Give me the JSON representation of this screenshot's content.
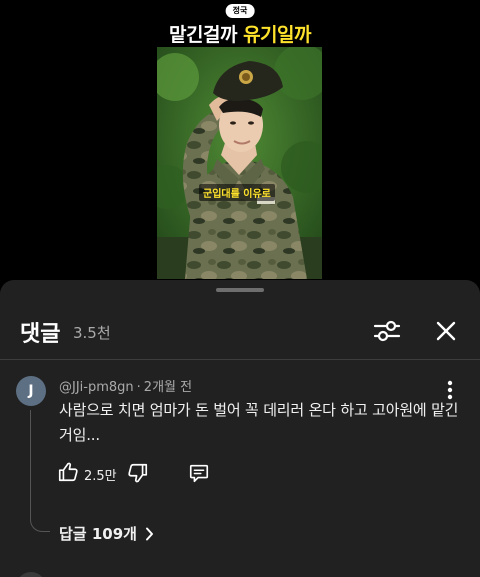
{
  "video": {
    "chip": "정국",
    "headline_white_1": "맡긴걸까 ",
    "headline_yellow": "유기일까",
    "caption": "군입대를 이유로"
  },
  "comments_panel": {
    "title": "댓글",
    "count": "3.5천",
    "icons": {
      "filter": "tune-icon",
      "close": "close-icon"
    }
  },
  "comment": {
    "avatar_letter": "J",
    "author": "@JJi-pm8gn",
    "separator": "·",
    "time": "2개월 전",
    "text": "사람으로 치면 엄마가 돈 벌어 꼭 데리러 온다 하고 고아원에 맡긴거임...",
    "likes": "2.5만",
    "replies_label": "답글 109개",
    "icons": {
      "like": "thumb-up-icon",
      "dislike": "thumb-down-icon",
      "reply": "comment-icon",
      "more": "more-vert-icon",
      "chevron": "chevron-right-icon"
    }
  },
  "colors": {
    "sheet_bg": "#212121",
    "accent_yellow": "#ffe22b",
    "text_secondary": "#aaaaaa",
    "avatar_bg": "#5c6f83"
  }
}
